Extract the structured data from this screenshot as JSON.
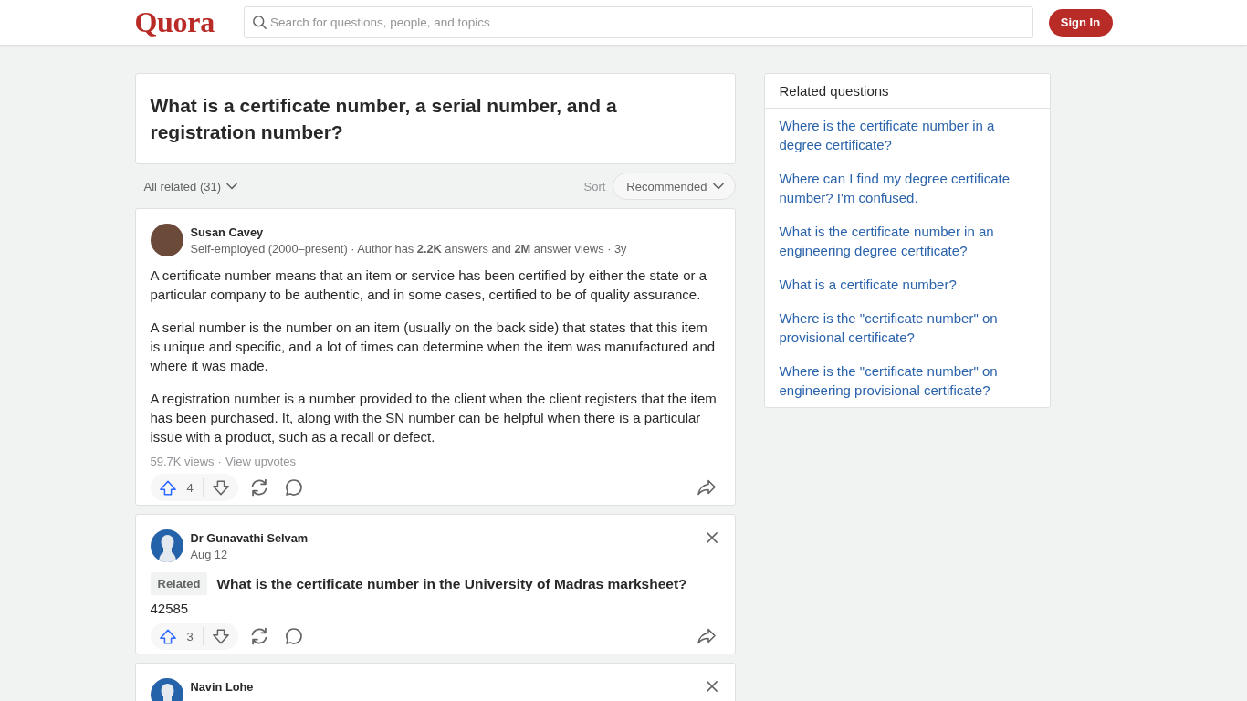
{
  "header": {
    "logo": "Quora",
    "search": {
      "placeholder": "Search for questions, people, and topics"
    },
    "sign_in": "Sign In"
  },
  "question": {
    "title": "What is a certificate number, a serial number, and a registration number?"
  },
  "filter_bar": {
    "filter": "All related (31)",
    "sort_label": "Sort",
    "sort_value": "Recommended"
  },
  "answers": [
    {
      "kind": "answer",
      "author": "Susan Cavey",
      "avatar": {
        "kind": "photo"
      },
      "credential": "Self-employed (2000–present) · Author has **2.2K** answers and **2M** answer views · 3y",
      "paragraphs": [
        "A certificate number means that an item or service has been certified by either the state or a particular company to be authentic, and in some cases, certified to be of quality assurance.",
        "A serial number is the number on an item (usually on the back side) that states that this item is unique and specific, and a lot of times can determine when the item was manufactured and where it was made.",
        "A registration number is a number provided to the client when the client registers that the item has been purchased. It, along with the SN number can be helpful when there is a particular issue with a product, such as a recall or defect."
      ],
      "stats": {
        "views": "59.7K views",
        "separator": "·",
        "link": "View upvotes"
      },
      "upvotes": "4",
      "dismissable": false
    },
    {
      "kind": "related",
      "author": "Dr Gunavathi Selvam",
      "avatar": {
        "kind": "default"
      },
      "date": "Aug 12",
      "badge": "Related",
      "question": "What is the certificate number in the University of Madras marksheet?",
      "body": "42585",
      "upvotes": "3",
      "dismissable": true
    },
    {
      "kind": "related",
      "author": "Navin Lohe",
      "avatar": {
        "kind": "default"
      },
      "dismissable": true
    }
  ],
  "sidebar": {
    "title": "Related questions",
    "links": [
      "Where is the certificate number in a degree certificate?",
      "Where can I find my degree certificate number? I'm confused.",
      "What is the certificate number in an engineering degree certificate?",
      "What is a certificate number?",
      "Where is the \"certificate number\" on provisional certificate?",
      "Where is the \"certificate number\" on engineering provisional certificate?"
    ]
  }
}
